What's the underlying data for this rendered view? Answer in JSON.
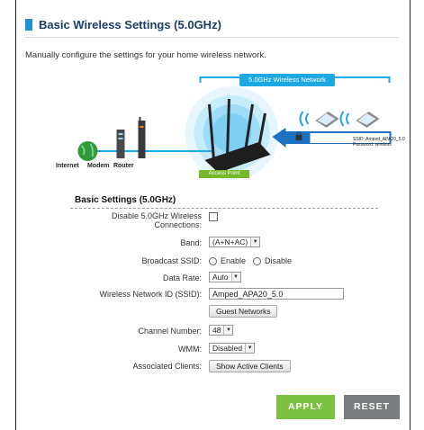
{
  "header": {
    "title": "Basic Wireless Settings (5.0GHz)",
    "description": "Manually configure the settings for your home wireless network."
  },
  "diagram": {
    "network_label": "5.0GHz Wireless Network",
    "internet": "Internet",
    "modem": "Modem",
    "router": "Router",
    "access_point": "Access Point",
    "ssid_line": "SSID: Amped_APA20_5.0",
    "password_line": "Password: wireless"
  },
  "section": {
    "title": "Basic Settings (5.0GHz)"
  },
  "form": {
    "disable_label": "Disable 5.0GHz Wireless Connections:",
    "disable_label_line1": "Disable 5.0GHz Wireless",
    "disable_label_line2": "Connections:",
    "band_label": "Band:",
    "band_value": "(A+N+AC)",
    "broadcast_label": "Broadcast SSID:",
    "broadcast_enable": "Enable",
    "broadcast_disable": "Disable",
    "data_rate_label": "Data Rate:",
    "data_rate_value": "Auto",
    "ssid_label": "Wireless Network ID (SSID):",
    "ssid_value": "Amped_APA20_5.0",
    "guest_button": "Guest Networks",
    "channel_label": "Channel Number:",
    "channel_value": "48",
    "wmm_label": "WMM:",
    "wmm_value": "Disabled",
    "clients_label": "Associated Clients:",
    "clients_button": "Show Active Clients"
  },
  "actions": {
    "apply": "APPLY",
    "reset": "RESET"
  },
  "colors": {
    "accent": "#1f8fd6",
    "apply": "#7cc242",
    "reset": "#7a7d80",
    "network_banner": "#1da7e3"
  }
}
